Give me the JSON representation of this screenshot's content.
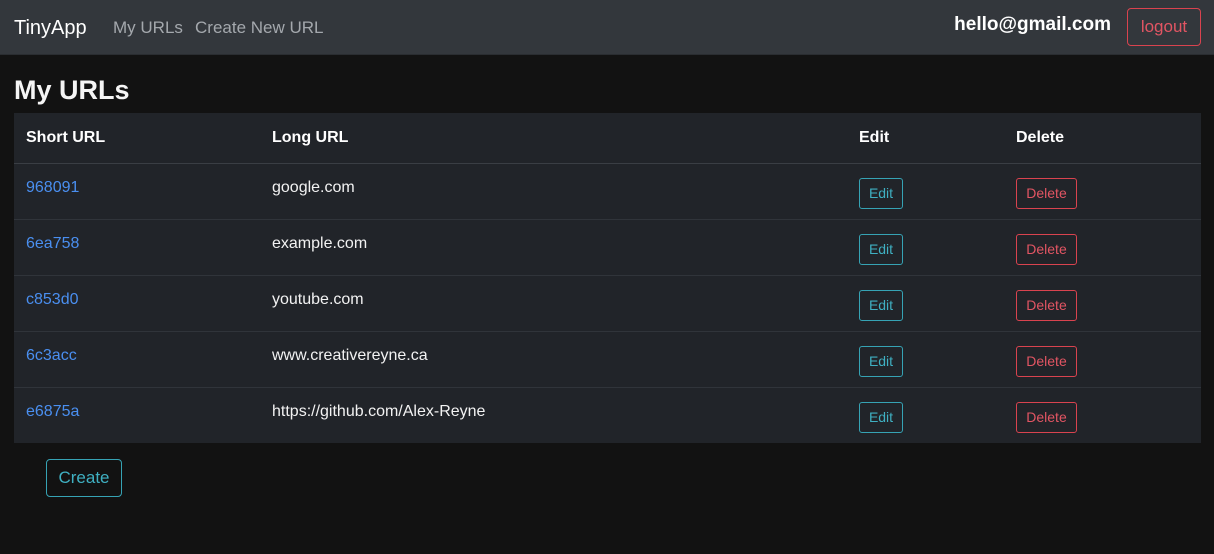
{
  "navbar": {
    "brand": "TinyApp",
    "links": [
      {
        "label": "My URLs"
      },
      {
        "label": "Create New URL"
      }
    ],
    "user_email": "hello@gmail.com",
    "logout_label": "logout"
  },
  "main": {
    "title": "My URLs",
    "table": {
      "headers": [
        "Short URL",
        "Long URL",
        "Edit",
        "Delete"
      ],
      "rows": [
        {
          "short": "968091",
          "long": "google.com",
          "edit": "Edit",
          "delete": "Delete"
        },
        {
          "short": "6ea758",
          "long": "example.com",
          "edit": "Edit",
          "delete": "Delete"
        },
        {
          "short": "c853d0",
          "long": "youtube.com",
          "edit": "Edit",
          "delete": "Delete"
        },
        {
          "short": "6c3acc",
          "long": "www.creativereyne.ca",
          "edit": "Edit",
          "delete": "Delete"
        },
        {
          "short": "e6875a",
          "long": "https://github.com/Alex-Reyne",
          "edit": "Edit",
          "delete": "Delete"
        }
      ]
    },
    "create_label": "Create"
  },
  "colors": {
    "navbar_bg": "#33373c",
    "page_bg": "#121212",
    "table_bg": "#212429",
    "link_blue": "#4a8ff0",
    "info_teal": "#3fb0c2",
    "danger_red": "#e25563"
  }
}
